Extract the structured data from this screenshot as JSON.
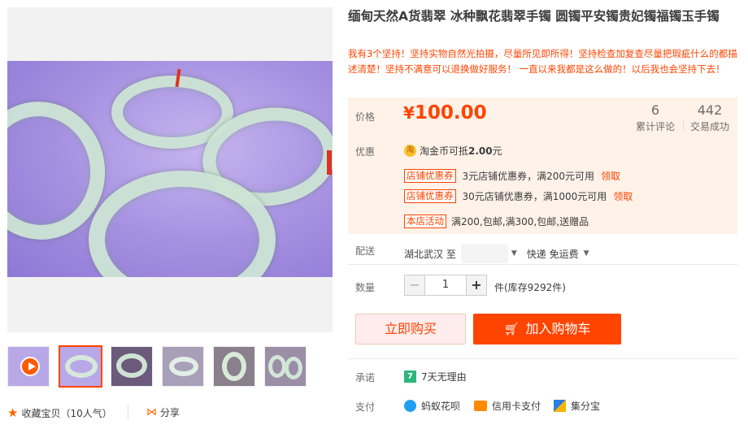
{
  "product": {
    "title": "缅甸天然A货翡翠 冰种飘花翡翠手镯 圆镯平安镯贵妃镯福镯玉手镯",
    "subtitle": "我有3个坚持！坚持实物自然光拍摄，尽量所见即所得！坚持检查加复查尽量把瑕疵什么的都描述清楚！坚持不满意可以退换做好服务！ 一直以来我都是这么做的！以后我也会坚持下去！"
  },
  "price": {
    "label": "价格",
    "currency": "¥",
    "value": "100.00",
    "reviews_count": "6",
    "reviews_label": "累计评论",
    "deals_count": "442",
    "deals_label": "交易成功"
  },
  "promo": {
    "label": "优惠",
    "coin_icon_text": "淘",
    "coin_text": "淘金币可抵",
    "coin_amount": "2.00",
    "coin_unit": "元",
    "coupons": [
      {
        "tag": "店铺优惠券",
        "text": "3元店铺优惠券，满200元可用",
        "link": "领取"
      },
      {
        "tag": "店铺优惠券",
        "text": "30元店铺优惠券，满1000元可用",
        "link": "领取"
      }
    ],
    "activity": {
      "tag": "本店活动",
      "text": "满200,包邮,满300,包邮,送赠品"
    }
  },
  "shipping": {
    "label": "配送",
    "from": "湖北武汉 至",
    "method": "快递 免运费"
  },
  "quantity": {
    "label": "数量",
    "value": "1",
    "minus": "−",
    "plus": "+",
    "unit": "件(库存9292件)"
  },
  "buttons": {
    "buy_now": "立即购买",
    "add_cart": "加入购物车"
  },
  "promise": {
    "label": "承诺",
    "icon_text": "7",
    "text": "7天无理由"
  },
  "payment": {
    "label": "支付",
    "methods": [
      "蚂蚁花呗",
      "信用卡支付",
      "集分宝"
    ]
  },
  "footer": {
    "favorite": "收藏宝贝（10人气）",
    "share": "分享"
  },
  "colors": {
    "accent": "#ff4400",
    "price_bg": "#fff2e8"
  }
}
